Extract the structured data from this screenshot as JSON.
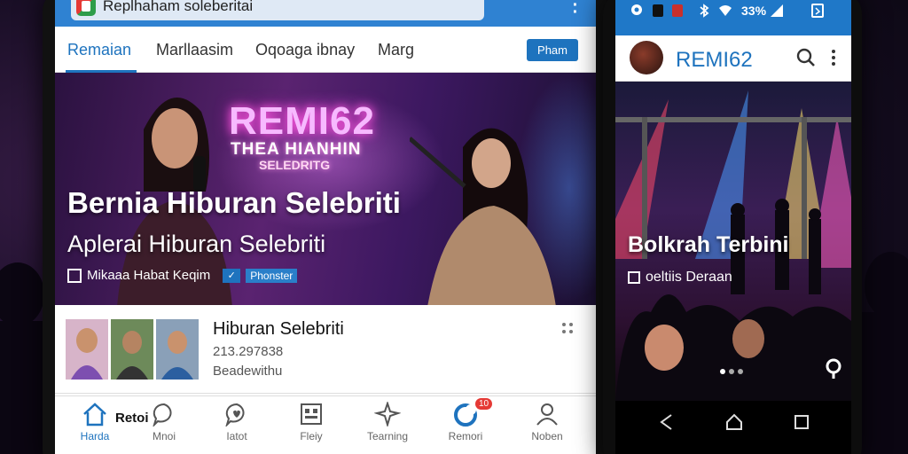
{
  "tablet": {
    "browser": {
      "url_text": "Replhaham soleberitai"
    },
    "tabs": [
      {
        "label": "Remaian",
        "active": true
      },
      {
        "label": "Marllaasim",
        "active": false
      },
      {
        "label": "Oqoaga ibnay",
        "active": false
      },
      {
        "label": "Marg",
        "active": false
      }
    ],
    "tab_button_label": "Pham",
    "hero": {
      "neon_title": "REMI62",
      "neon_subtitle": "THEA HIANHIN",
      "neon_subtitle2": "SELEDRITG",
      "title": "Bernia Hiburan Selebriti",
      "subtitle": "Aplerai Hiburan Selebriti",
      "meta_text": "Mikaaa Habat Keqim",
      "meta_tag": "Phonster"
    },
    "card": {
      "title": "Hiburan Selebriti",
      "line2": "213.297838",
      "line3": "Beadewithu"
    },
    "bottom_nav": [
      {
        "label": "Harda",
        "icon": "home-icon",
        "active": true,
        "extra": "Retoi"
      },
      {
        "label": "Mnoi",
        "icon": "chat-bubble-icon",
        "active": false
      },
      {
        "label": "Iatot",
        "icon": "heart-chat-icon",
        "active": false
      },
      {
        "label": "Fleiy",
        "icon": "grid-box-icon",
        "active": false
      },
      {
        "label": "Tearning",
        "icon": "sparkle-icon",
        "active": false
      },
      {
        "label": "Remori",
        "icon": "notification-icon",
        "active": false,
        "badge": "10"
      },
      {
        "label": "Noben",
        "icon": "profile-icon",
        "active": false
      }
    ]
  },
  "phone": {
    "status": {
      "battery_text": "33%"
    },
    "brand": "REMI62",
    "stage": {
      "title": "Bolkrah Terbini",
      "subtitle": "oeltiis Deraan"
    }
  },
  "colors": {
    "accent": "#1e73be",
    "status_bar": "#2f82d2",
    "neon_pink": "#ff5fe0",
    "badge": "#e53935"
  }
}
